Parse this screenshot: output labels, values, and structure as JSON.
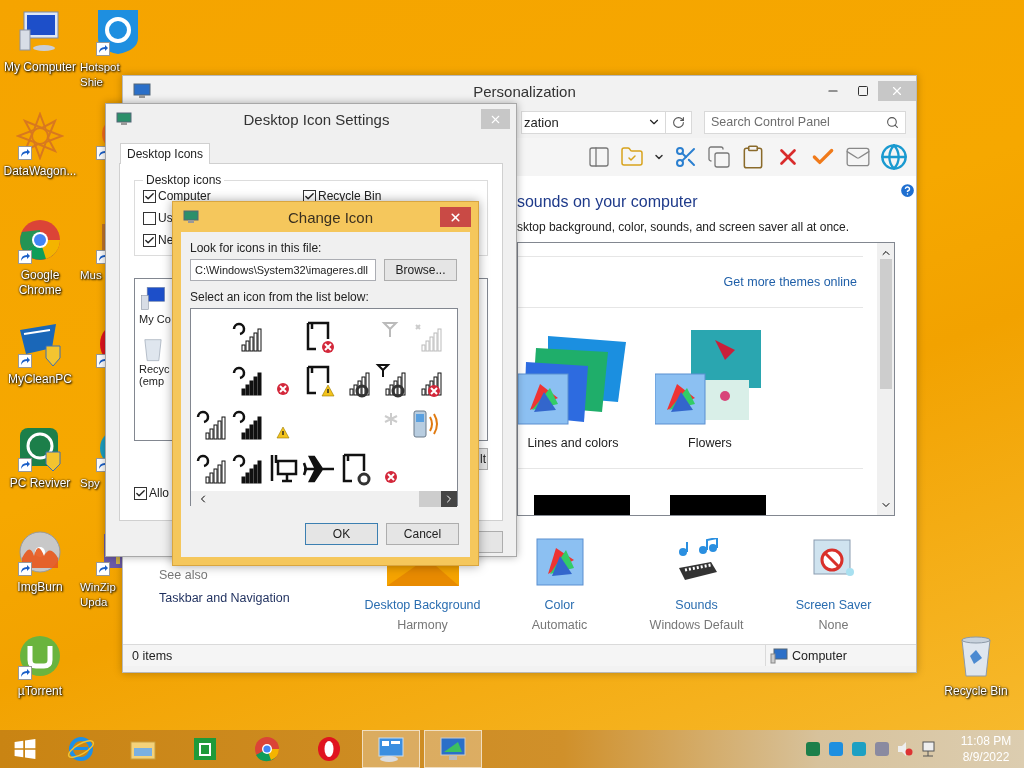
{
  "desktop": {
    "icons_column_1": [
      {
        "kind": "computer",
        "label": "My Computer"
      },
      {
        "kind": "mandala",
        "label": "DataWagon..."
      },
      {
        "kind": "chrome",
        "label": "Google Chrome"
      },
      {
        "kind": "cleaner",
        "label": "MyCleanPC"
      },
      {
        "kind": "reviver",
        "label": "PC Reviver"
      },
      {
        "kind": "disc",
        "label": "ImgBurn"
      },
      {
        "kind": "torrent",
        "label": "µTorrent"
      }
    ],
    "icons_column_2": [
      {
        "kind": "hotspot",
        "label": "Hotspot Shie"
      },
      {
        "kind": "avast"
      },
      {
        "kind": "music",
        "label": "Mus"
      },
      {
        "kind": "opera"
      },
      {
        "kind": "spy",
        "label": "Spy"
      },
      {
        "kind": "winzip",
        "label": "WinZip Upda"
      }
    ],
    "recycle_bin": {
      "kind": "recycle",
      "label": "Recycle Bin"
    }
  },
  "personalization": {
    "title": "Personalization",
    "address": "zation",
    "search_placeholder": "Search Control Panel",
    "heading": "sounds on your computer",
    "subtitle": "sktop background, color, sounds, and screen saver all at once.",
    "themes_link": "Get more themes online",
    "themes": [
      {
        "kind": "lines",
        "name": "Lines and colors"
      },
      {
        "kind": "flowers",
        "name": "Flowers"
      }
    ],
    "see_also": {
      "heading": "See also",
      "links": [
        "Taskbar and Navigation"
      ]
    },
    "settings": [
      {
        "kind": "background",
        "label": "Desktop Background",
        "value": "Harmony"
      },
      {
        "kind": "color",
        "label": "Color",
        "value": "Automatic"
      },
      {
        "kind": "sounds",
        "label": "Sounds",
        "value": "Windows Default"
      },
      {
        "kind": "screensaver",
        "label": "Screen Saver",
        "value": "None"
      }
    ],
    "status_bar": {
      "items": "0 items",
      "location": "Computer"
    }
  },
  "desktop_icon_settings": {
    "title": "Desktop Icon Settings",
    "tabs": [
      {
        "label": "Desktop Icons",
        "selected": true
      }
    ],
    "group_title": "Desktop icons",
    "checkboxes": [
      {
        "label": "Computer",
        "checked": true
      },
      {
        "label": "Us",
        "checked": false
      },
      {
        "label": "Ne",
        "checked": true
      },
      {
        "label": "Recycle Bin",
        "checked": true
      }
    ],
    "icon_list": [
      {
        "kind": "computer",
        "lines": [
          "My Co"
        ]
      },
      {
        "kind": "recycle",
        "lines": [
          "Recyc",
          "(emp"
        ]
      }
    ],
    "restore_button": "lt",
    "allow_checkbox": {
      "label": "Allo",
      "checked": true
    }
  },
  "change_icon": {
    "title": "Change Icon",
    "file_label": "Look for icons in this file:",
    "file_path": "C:\\Windows\\System32\\imageres.dll",
    "browse_button": "Browse...",
    "list_label": "Select an icon from the list below:",
    "buttons": [
      {
        "label": "OK",
        "default": true
      },
      {
        "label": "Cancel",
        "default": false
      }
    ]
  },
  "taskbar": {
    "apps": [
      {
        "kind": "start",
        "active": false
      },
      {
        "kind": "ie",
        "active": false
      },
      {
        "kind": "explorer",
        "active": false
      },
      {
        "kind": "store",
        "active": false
      },
      {
        "kind": "chrome",
        "active": false
      },
      {
        "kind": "opera",
        "active": false
      },
      {
        "kind": "control",
        "active": true
      },
      {
        "kind": "personalize",
        "active": true
      }
    ],
    "time": "11:08 PM",
    "date": "8/9/2022"
  }
}
